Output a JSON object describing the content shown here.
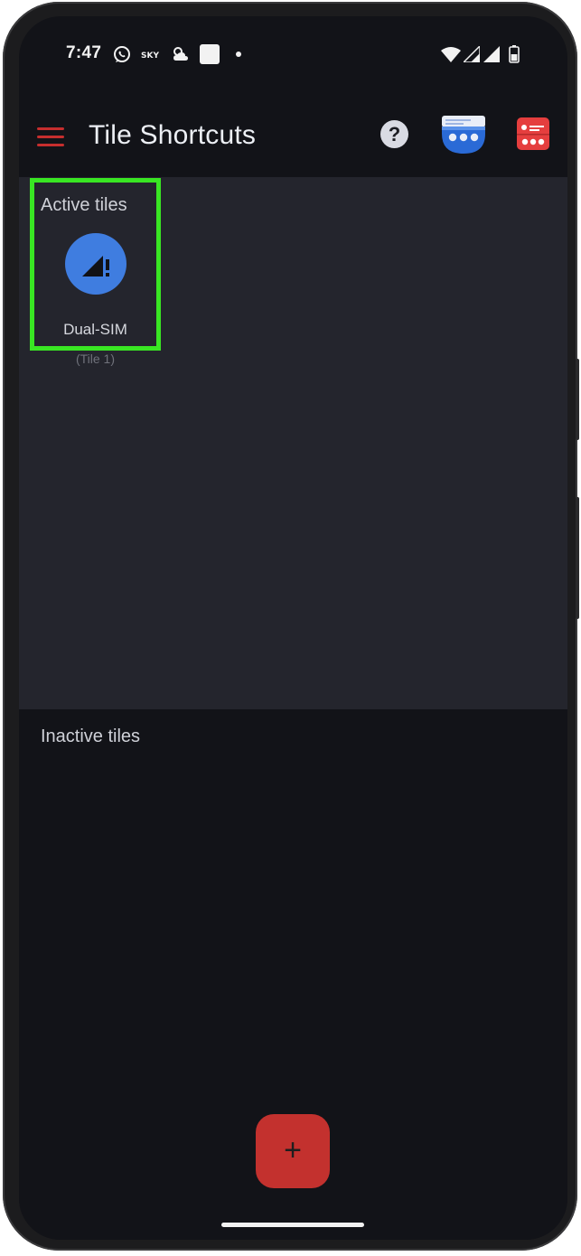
{
  "status_bar": {
    "time": "7:47",
    "icons": [
      "viber-icon",
      "sky-icon",
      "weather-icon",
      "square-notification-icon",
      "dot-icon",
      "wifi-icon",
      "signal-icon",
      "signal-icon-2",
      "battery-icon"
    ]
  },
  "app_bar": {
    "title": "Tile Shortcuts",
    "help_label": "?",
    "accent_color": "#c62e2e"
  },
  "active_section": {
    "label": "Active tiles",
    "tiles": [
      {
        "name": "Dual-SIM",
        "subtitle": "(Tile 1)",
        "icon": "signal-alert-icon",
        "color": "#3f7de0"
      }
    ]
  },
  "inactive_section": {
    "label": "Inactive tiles"
  },
  "fab": {
    "label": "+",
    "color": "#c3312e"
  },
  "highlight_color": "#39e623"
}
